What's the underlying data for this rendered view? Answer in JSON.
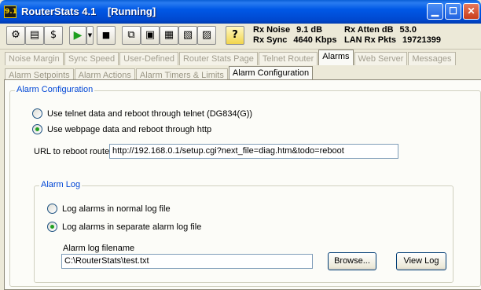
{
  "window": {
    "app_name": "RouterStats 4.1",
    "state": "[Running]",
    "icon_text": "9.1",
    "minimize_icon": "minimize-icon",
    "maximize_icon": "maximize-icon",
    "close_icon": "close-icon"
  },
  "toolbar": {
    "buttons": [
      "router-connect-icon",
      "save-icon",
      "currency-icon",
      "play-icon",
      "dropdown-icon",
      "stop-icon",
      "copy-icon",
      "paste-icon",
      "report-icon",
      "report-alt-icon",
      "report-settings-icon",
      "help-icon"
    ]
  },
  "status": {
    "rx_noise_label": "Rx Noise",
    "rx_noise_value": "9.1 dB",
    "rx_sync_label": "Rx Sync",
    "rx_sync_value": "4640 Kbps",
    "rx_atten_label": "Rx Atten dB",
    "rx_atten_value": "53.0",
    "lan_rx_label": "LAN Rx Pkts",
    "lan_rx_value": "19721399"
  },
  "main_tabs": [
    {
      "label": "Noise Margin"
    },
    {
      "label": "Sync Speed"
    },
    {
      "label": "User-Defined"
    },
    {
      "label": "Router Stats Page"
    },
    {
      "label": "Telnet Router"
    },
    {
      "label": "Alarms"
    },
    {
      "label": "Web Server"
    },
    {
      "label": "Messages"
    }
  ],
  "sub_tabs": [
    {
      "label": "Alarm Setpoints"
    },
    {
      "label": "Alarm Actions"
    },
    {
      "label": "Alarm Timers & Limits"
    },
    {
      "label": "Alarm Configuration"
    }
  ],
  "alarm_config": {
    "legend": "Alarm Configuration",
    "option_telnet": "Use telnet data and reboot through telnet (DG834(G))",
    "option_webpage": "Use webpage data and reboot through http",
    "url_label": "URL to reboot router",
    "url_value": "http://192.168.0.1/setup.cgi?next_file=diag.htm&todo=reboot"
  },
  "alarm_log": {
    "legend": "Alarm Log",
    "option_normal": "Log alarms in normal log file",
    "option_separate": "Log alarms in separate alarm log file",
    "filename_label": "Alarm log filename",
    "filename_value": "C:\\RouterStats\\test.txt",
    "browse_label": "Browse...",
    "view_log_label": "View Log"
  }
}
